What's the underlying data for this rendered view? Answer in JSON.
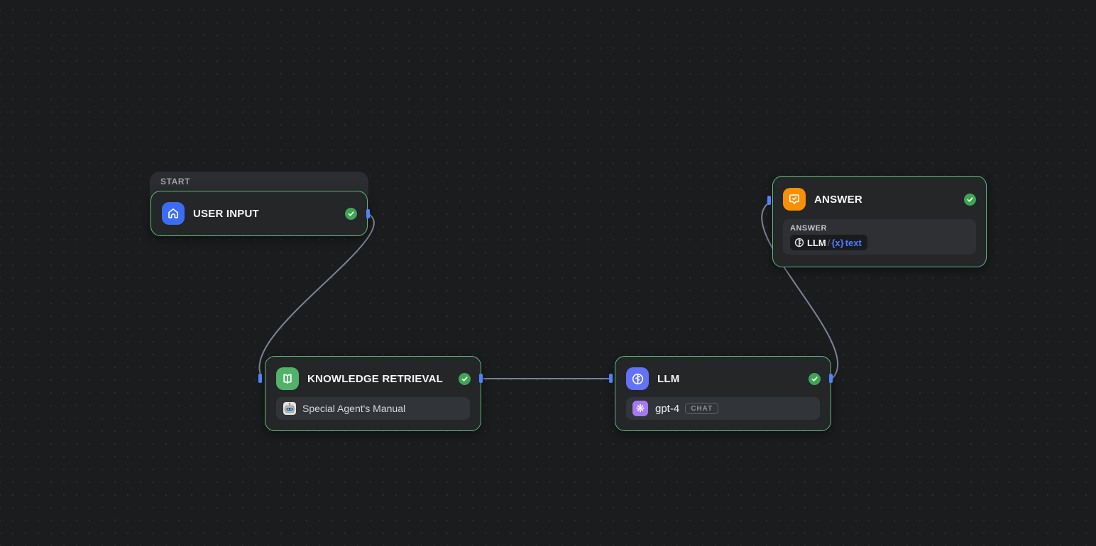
{
  "canvas": {
    "background": "#1b1c1e",
    "dot_color": "#2a2c2f"
  },
  "start_group": {
    "label": "START"
  },
  "nodes": {
    "user_input": {
      "title": "USER INPUT",
      "icon": "home-icon",
      "icon_color": "#3b6cf3",
      "status": "success"
    },
    "knowledge_retrieval": {
      "title": "KNOWLEDGE RETRIEVAL",
      "icon": "open-book-icon",
      "icon_color": "#52b26a",
      "dataset": "Special Agent's Manual",
      "dataset_icon": "robot-emoji-icon",
      "status": "success"
    },
    "llm": {
      "title": "LLM",
      "icon": "brain-circle-icon",
      "icon_color": "#6372f6",
      "model": "gpt-4",
      "model_icon": "openai-icon",
      "mode_badge": "CHAT",
      "status": "success"
    },
    "answer": {
      "title": "ANSWER",
      "icon": "chat-check-icon",
      "icon_color": "#f79009",
      "panel_label": "ANSWER",
      "variable": {
        "icon": "brain-circle-icon",
        "node": "LLM",
        "separator": "/",
        "x_prefix": "{x}",
        "field": "text"
      },
      "status": "success"
    }
  },
  "edges": [
    {
      "from": "user_input",
      "to": "knowledge_retrieval"
    },
    {
      "from": "knowledge_retrieval",
      "to": "llm"
    },
    {
      "from": "llm",
      "to": "answer"
    }
  ],
  "colors": {
    "node_border": "#5abc7c",
    "status_green": "#3fa554",
    "handle_blue": "#4e83fd",
    "edge_gray": "#7d8496",
    "variable_blue": "#4e7fff"
  }
}
